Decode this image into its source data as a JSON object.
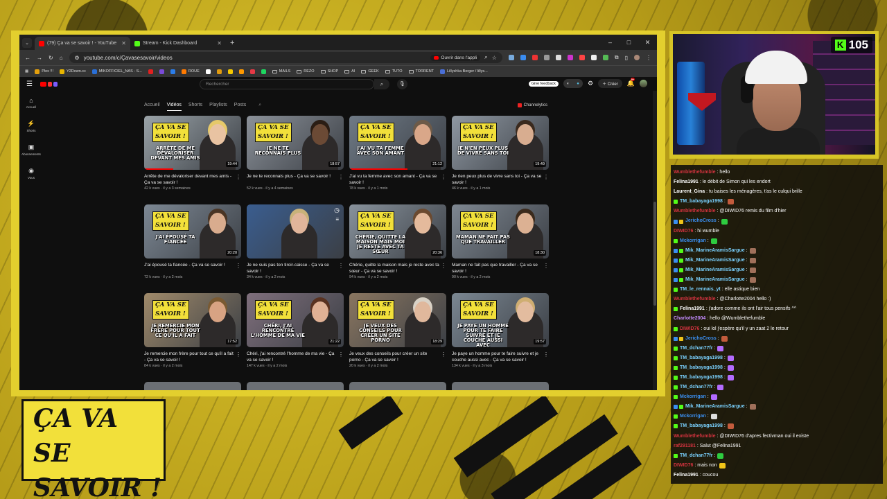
{
  "colors": {
    "accent_yellow": "#e3cf2e",
    "yt_red": "#ff0000",
    "kick_green": "#53fc18"
  },
  "browser": {
    "tabs": [
      {
        "title": "(79) Ça va se savoir ! - YouTube",
        "icon": "youtube-icon",
        "color": "#ff0000",
        "active": true
      },
      {
        "title": "Stream - Kick Dashboard",
        "icon": "kick-icon",
        "color": "#53fc18",
        "active": false
      }
    ],
    "new_tab": "+",
    "window_controls": [
      "–",
      "□",
      "✕"
    ],
    "url": "youtube.com/c/Çavasesavoir/videos",
    "open_app_label": "Ouvrir dans l'appli",
    "bookmarks": [
      {
        "label": "Plex !!!",
        "color": "#e5a00d"
      },
      {
        "label": "Y2Down.cc",
        "color": "#e8b500"
      },
      {
        "label": "MIKOFFICIEL_NAS - S...",
        "color": "#2a6fd6"
      },
      {
        "label": "",
        "color": "#e02020"
      },
      {
        "label": "",
        "color": "#7a4bd8"
      },
      {
        "label": "",
        "color": "#2b7de9"
      },
      {
        "label": "ROUE",
        "color": "#ff7a00"
      },
      {
        "label": "",
        "color": "#ffffff"
      },
      {
        "label": "",
        "color": "#e09b10"
      },
      {
        "label": "",
        "color": "#f5c800"
      },
      {
        "label": "",
        "color": "#ff9900"
      },
      {
        "label": "",
        "color": "#e63946"
      },
      {
        "label": "",
        "color": "#1ed760"
      },
      {
        "label": "MAILS",
        "folder": true
      },
      {
        "label": "REZO",
        "folder": true
      },
      {
        "label": "SHOP",
        "folder": true
      },
      {
        "label": "AI",
        "folder": true
      },
      {
        "label": "GEEK",
        "folder": true
      },
      {
        "label": "TUTO",
        "folder": true
      },
      {
        "label": "TORRENT",
        "folder": true
      },
      {
        "label": "Lillyshka Berger / lillys...",
        "color": "#4a6fd6"
      }
    ]
  },
  "youtube": {
    "search_placeholder": "Rechercher",
    "feedback_label": "Give feedback",
    "create_label": "Créer",
    "notif_count": "9+",
    "sidebar": [
      {
        "label": "Accueil",
        "icon": "⌂"
      },
      {
        "label": "Shorts",
        "icon": "⚡"
      },
      {
        "label": "Abonnements",
        "icon": "▣"
      },
      {
        "label": "Vous",
        "icon": "◉"
      }
    ],
    "channel_tabs": [
      "Accueil",
      "Vidéos",
      "Shorts",
      "Playlists",
      "Posts"
    ],
    "active_tab": "Vidéos",
    "channelytics": "Channelytics",
    "logo_line1": "ÇA VA SE",
    "logo_line2": "SAVOIR !",
    "videos": [
      {
        "title": "Arrête de me dévaloriser devant mes amis - Ça va se savoir !",
        "meta": "42 k vues · il y a 3 semaines",
        "duration": "19:44",
        "tagline": "ARRÊTE DE ME DÉVALORISER DEVANT MES AMIS",
        "bg": "#9aa3a8",
        "skin": "#e9c3a2",
        "hair": "#e6c96a",
        "progress": 0.3
      },
      {
        "title": "Je ne te reconnais plus - Ça va se savoir !",
        "meta": "52 k vues · il y a 4 semaines",
        "duration": "18:57",
        "tagline": "JE NE TE RECONNAIS PLUS",
        "bg": "#8b9199",
        "skin": "#6b4a35",
        "hair": "#2a1d14",
        "progress": 0.0
      },
      {
        "title": "J'ai vu ta femme avec son amant - Ça va se savoir !",
        "meta": "78 k vues · il y a 1 mois",
        "duration": "21:12",
        "tagline": "J'AI VU TA FEMME AVEC SON AMANT",
        "bg": "#6f7a86",
        "skin": "#d9a789",
        "hair": "#6d5a48",
        "progress": 0.6
      },
      {
        "title": "Je rien peux plus de vivre sans toi - Ça va se savoir !",
        "meta": "46 k vues · il y a 1 mois",
        "duration": "19:49",
        "tagline": "JE N'EN PEUX PLUS DE VIVRE SANS TOI",
        "bg": "#8f98a2",
        "skin": "#d8ad90",
        "hair": "#3a2a1e",
        "progress": 0.0
      },
      {
        "title": "J'ai épousé ta fiancée - Ça va se savoir !",
        "meta": "72 k vues · il y a 2 mois",
        "duration": "20:20",
        "tagline": "J'AI ÉPOUSÉ TA FIANCÉE",
        "bg": "#7d8894",
        "skin": "#d9ac8e",
        "hair": "#4a3524",
        "progress": 0.0
      },
      {
        "title": "Je ne suis pas ton tiroir-caisse - Ça va se savoir !",
        "meta": "34 k vues · il y a 2 mois",
        "duration": "",
        "tagline": "",
        "bg": "#3a5d8f",
        "skin": "#e1b59a",
        "hair": "#c9b27a",
        "progress": 0.0,
        "nologo": true
      },
      {
        "title": "Chérie, quitte la maison mais je reste avec ta sœur - Ça va se savoir !",
        "meta": "94 k vues · il y a 2 mois",
        "duration": "20:36",
        "tagline": "CHÉRIE, QUITTE LA MAISON MAIS MOI JE RESTE AVEC TA SŒUR",
        "bg": "#88929c",
        "skin": "#e4ba9c",
        "hair": "#6b4a30",
        "progress": 0.0
      },
      {
        "title": "Maman ne fait pas que travailler - Ça va se savoir !",
        "meta": "90 k vues · il y a 2 mois",
        "duration": "18:30",
        "tagline": "MAMAN NE FAIT PAS QUE TRAVAILLER",
        "bg": "#7e8791",
        "skin": "#dcb193",
        "hair": "#3b2a1c",
        "progress": 0.0
      },
      {
        "title": "Je remercie mon frère pour tout ce qu'il a fait - Ça va se savoir !",
        "meta": "84 k vues · il y a 2 mois",
        "duration": "17:52",
        "tagline": "JE REMERCIE MON FRÈRE POUR TOUT CE QU'IL A FAIT",
        "bg": "#a08a6a",
        "skin": "#d8a383",
        "hair": "#7a5a32",
        "progress": 0.0
      },
      {
        "title": "Chéri, j'ai rencontré l'homme de ma vie - Ça va se savoir !",
        "meta": "147 k vues · il y a 2 mois",
        "duration": "21:22",
        "tagline": "CHÉRI, J'AI RENCONTRÉ L'HOMME DE MA VIE",
        "bg": "#7f6f7c",
        "skin": "#e0b195",
        "hair": "#5a3220",
        "progress": 0.0
      },
      {
        "title": "Je veux des conseils pour créer un site porno - Ça va se savoir !",
        "meta": "20 k vues · il y a 2 mois",
        "duration": "18:29",
        "tagline": "JE VEUX DES CONSEILS POUR CRÉER UN SITE PORNO",
        "bg": "#8a7660",
        "skin": "#e0b89c",
        "hair": "#d9d2c6",
        "progress": 0.0
      },
      {
        "title": "Je paye un homme pour te faire suivre et je couche aussi avec - Ça va se savoir !",
        "meta": "134 k vues · il y a 3 mois",
        "duration": "19:57",
        "tagline": "JE PAYE UN HOMME POUR TE FAIRE SUIVRE ET JE COUCHE AUSSI AVEC",
        "bg": "#7b8792",
        "skin": "#e3bc9f",
        "hair": "#cfae72",
        "progress": 0.0
      }
    ]
  },
  "stream": {
    "viewer_count": "105",
    "chat": [
      {
        "user": "Wumblethefumble",
        "color": "#d4333f",
        "text": ": hello",
        "badges": []
      },
      {
        "user": "Felina1991",
        "color": "#ffffff",
        "text": ": le débit de Simon qui les endort",
        "badges": []
      },
      {
        "user": "Laurent_Gina",
        "color": "#ffffff",
        "text": ": tu baises les ménagères, t'as le culqui brille",
        "badges": []
      },
      {
        "user": "TM_babayaga1998",
        "color": "#7ad1ff",
        "text": ":",
        "badges": [
          "#53fc18"
        ],
        "emote": "#c25b3c"
      },
      {
        "user": "Wumblethefumble",
        "color": "#d4333f",
        "text": ": @DIWID76 remis du film d'hier",
        "badges": []
      },
      {
        "user": "JerichoCross",
        "color": "#3b8ff0",
        "text": ":",
        "badges": [
          "#3b8ff0",
          "#f0c419"
        ],
        "emote": "#2ecc40"
      },
      {
        "user": "DIWID76",
        "color": "#d4333f",
        "text": ": hi wumble",
        "badges": []
      },
      {
        "user": "Mckorrigan",
        "color": "#3b8ff0",
        "text": ":",
        "badges": [
          "#53fc18"
        ],
        "emote": "#2ecc40"
      },
      {
        "user": "Mik_MarineAramisSargue",
        "color": "#7ad1ff",
        "text": ":",
        "badges": [
          "#3b8ff0",
          "#53fc18"
        ],
        "emote": "#a0705a"
      },
      {
        "user": "Mik_MarineAramisSargue",
        "color": "#7ad1ff",
        "text": ":",
        "badges": [
          "#3b8ff0",
          "#53fc18"
        ],
        "emote": "#a0705a"
      },
      {
        "user": "Mik_MarineAramisSargue",
        "color": "#7ad1ff",
        "text": ":",
        "badges": [
          "#3b8ff0",
          "#53fc18"
        ],
        "emote": "#a0705a"
      },
      {
        "user": "Mik_MarineAramisSargue",
        "color": "#7ad1ff",
        "text": ":",
        "badges": [
          "#3b8ff0",
          "#53fc18"
        ],
        "emote": "#a0705a"
      },
      {
        "user": "TM_le_rennais_yt",
        "color": "#7ad1ff",
        "text": ": elle astique bien",
        "badges": [
          "#53fc18"
        ]
      },
      {
        "user": "Wumblethefumble",
        "color": "#d4333f",
        "text": ": @Charlotte2004 hello :)",
        "badges": []
      },
      {
        "user": "Felina1991",
        "color": "#ffffff",
        "text": ": j'adore comme ils ont l'air tous pensifs ^^",
        "badges": [
          "#53fc18"
        ]
      },
      {
        "user": "Charlotte2004",
        "color": "#c58cff",
        "text": ": hello @Wumblethefumble",
        "badges": []
      },
      {
        "user": "DIWID76",
        "color": "#d4333f",
        "text": ": oui lol j'espère qu'il y un zaat 2 le retour",
        "badges": [
          "#53fc18"
        ]
      },
      {
        "user": "JerichoCross",
        "color": "#3b8ff0",
        "text": ":",
        "badges": [
          "#3b8ff0",
          "#f0c419"
        ],
        "emote": "#c25b3c"
      },
      {
        "user": "TM_dchan77fr",
        "color": "#7ad1ff",
        "text": ":",
        "badges": [
          "#53fc18"
        ],
        "emote": "#b36bff"
      },
      {
        "user": "TM_babayaga1998",
        "color": "#7ad1ff",
        "text": ":",
        "badges": [
          "#53fc18"
        ],
        "emote": "#b36bff"
      },
      {
        "user": "TM_babayaga1998",
        "color": "#7ad1ff",
        "text": ":",
        "badges": [
          "#53fc18"
        ],
        "emote": "#b36bff"
      },
      {
        "user": "TM_babayaga1998",
        "color": "#7ad1ff",
        "text": ":",
        "badges": [
          "#53fc18"
        ],
        "emote": "#b36bff"
      },
      {
        "user": "TM_dchan77fr",
        "color": "#7ad1ff",
        "text": ":",
        "badges": [
          "#53fc18"
        ],
        "emote": "#b36bff"
      },
      {
        "user": "Mckorrigan",
        "color": "#3b8ff0",
        "text": ":",
        "badges": [
          "#53fc18"
        ],
        "emote": "#b36bff"
      },
      {
        "user": "Mik_MarineAramisSargue",
        "color": "#7ad1ff",
        "text": ":",
        "badges": [
          "#3b8ff0",
          "#53fc18"
        ],
        "emote": "#a0705a"
      },
      {
        "user": "Mckorrigan",
        "color": "#3b8ff0",
        "text": ":",
        "badges": [
          "#53fc18"
        ],
        "emote": "#dddddd"
      },
      {
        "user": "TM_babayaga1998",
        "color": "#7ad1ff",
        "text": ":",
        "badges": [
          "#53fc18"
        ],
        "emote": "#c25b3c"
      },
      {
        "user": "Wumblethefumble",
        "color": "#d4333f",
        "text": ": @DIWID76 d'apres fectivman oui il existe",
        "badges": []
      },
      {
        "user": "raf291181",
        "color": "#d4333f",
        "text": ": Salut @Felina1991",
        "badges": []
      },
      {
        "user": "TM_dchan77fr",
        "color": "#7ad1ff",
        "text": ":",
        "badges": [
          "#53fc18"
        ],
        "emote": "#2ecc40"
      },
      {
        "user": "DIWID76",
        "color": "#d4333f",
        "text": ": mais non",
        "badges": [],
        "emote": "#f0c419"
      },
      {
        "user": "Felina1991",
        "color": "#ffffff",
        "text": ": coucou",
        "badges": []
      }
    ]
  },
  "overlay_logo": {
    "line1": "ÇA VA SE",
    "line2": "SAVOIR !"
  }
}
